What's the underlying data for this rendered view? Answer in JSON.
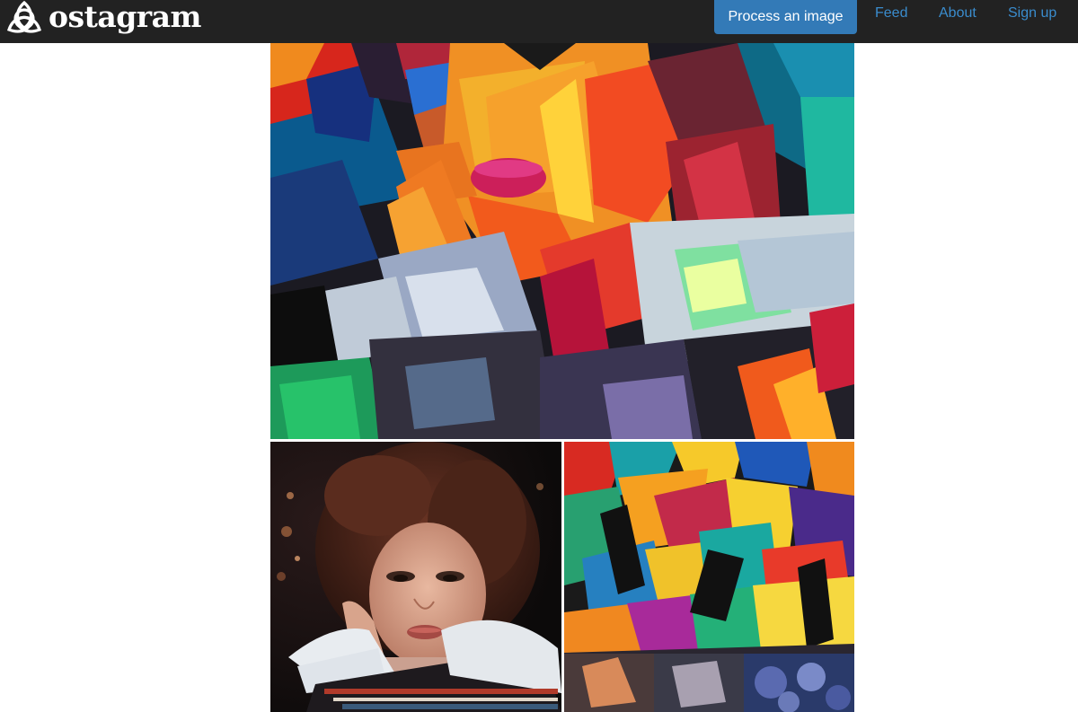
{
  "nav": {
    "brand_name": "ostagram",
    "brand_icon": "triquetra-logo-icon",
    "cta_label": "Process an image",
    "links": [
      "Feed",
      "About",
      "Sign up"
    ]
  },
  "colors": {
    "navbar_bg": "#222222",
    "cta_bg": "#337ab7",
    "link": "#3a8ccd",
    "page_bg": "#ffffff"
  },
  "images": [
    {
      "role": "result",
      "description": "cubist painting of a woman with pink lips"
    },
    {
      "role": "content",
      "description": "portrait photo of a woman with curly brown hair"
    },
    {
      "role": "style",
      "description": "abstract geometric colorful painting"
    }
  ]
}
